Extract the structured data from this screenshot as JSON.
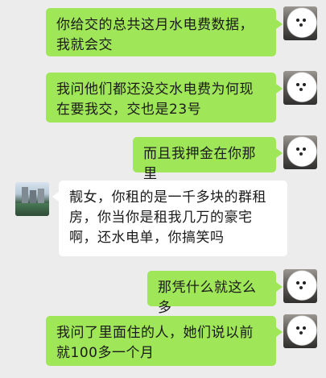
{
  "chat": {
    "messages": [
      {
        "side": "right",
        "avatar": "dog-avatar",
        "text": "你给交的总共这月水电费数据，我就会交"
      },
      {
        "side": "right",
        "avatar": "dog-avatar",
        "text": "我问他们都还没交水电费为何现在要我交，交也是23号"
      },
      {
        "side": "right",
        "avatar": "dog-avatar",
        "text": "而且我押金在你那里"
      },
      {
        "side": "left",
        "avatar": "city-avatar",
        "text": "靓女，你租的是一千多块的群租房，你当你是租我几万的豪宅啊，还水电单，你搞笑吗"
      },
      {
        "side": "right",
        "avatar": "dog-avatar",
        "text": "那凭什么就这么多"
      },
      {
        "side": "right",
        "avatar": "dog-avatar",
        "text": "我问了里面住的人，她们说以前就100多一个月"
      }
    ]
  },
  "colors": {
    "background": "#ececec",
    "outgoing_bubble": "#9fe658",
    "incoming_bubble": "#ffffff",
    "text": "#1a1a1a"
  }
}
